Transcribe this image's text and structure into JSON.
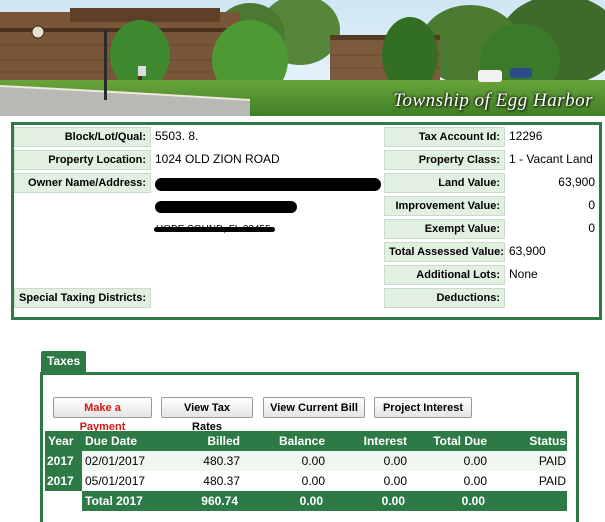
{
  "banner": {
    "title": "Township of Egg Harbor"
  },
  "property": {
    "block_lot_qual": {
      "label": "Block/Lot/Qual:",
      "value": "5503.  8."
    },
    "property_location": {
      "label": "Property Location:",
      "value": "1024 OLD ZION ROAD"
    },
    "owner_name_address": {
      "label": "Owner Name/Address:",
      "value_line3": "HOBE SOUND, FL 33455"
    },
    "special_taxing_districts": {
      "label": "Special Taxing Districts:",
      "value": ""
    },
    "tax_account_id": {
      "label": "Tax Account Id:",
      "value": "12296"
    },
    "property_class": {
      "label": "Property Class:",
      "value": "1 - Vacant Land"
    },
    "land_value": {
      "label": "Land Value:",
      "value": "63,900"
    },
    "improvement_value": {
      "label": "Improvement Value:",
      "value": "0"
    },
    "exempt_value": {
      "label": "Exempt Value:",
      "value": "0"
    },
    "total_assessed_value": {
      "label": "Total Assessed Value:",
      "value": "63,900"
    },
    "additional_lots": {
      "label": "Additional Lots:",
      "value": "None"
    },
    "deductions": {
      "label": "Deductions:",
      "value": ""
    }
  },
  "taxes": {
    "tab_label": "Taxes",
    "buttons": {
      "make_payment": "Make a Payment",
      "view_tax_rates": "View Tax Rates",
      "view_current_bill": "View Current Bill",
      "project_interest": "Project Interest"
    },
    "columns": {
      "year": "Year",
      "due_date": "Due Date",
      "billed": "Billed",
      "balance": "Balance",
      "interest": "Interest",
      "total_due": "Total Due",
      "status": "Status"
    },
    "rows": [
      {
        "year": "2017",
        "due_date": "02/01/2017",
        "billed": "480.37",
        "balance": "0.00",
        "interest": "0.00",
        "total_due": "0.00",
        "status": "PAID"
      },
      {
        "year": "2017",
        "due_date": "05/01/2017",
        "billed": "480.37",
        "balance": "0.00",
        "interest": "0.00",
        "total_due": "0.00",
        "status": "PAID"
      }
    ],
    "total": {
      "label": "Total 2017",
      "billed": "960.74",
      "balance": "0.00",
      "interest": "0.00",
      "total_due": "0.00"
    }
  },
  "colors": {
    "accent": "#2d7a47",
    "label_bg": "#e2f0e2",
    "button_red": "#d01818"
  }
}
